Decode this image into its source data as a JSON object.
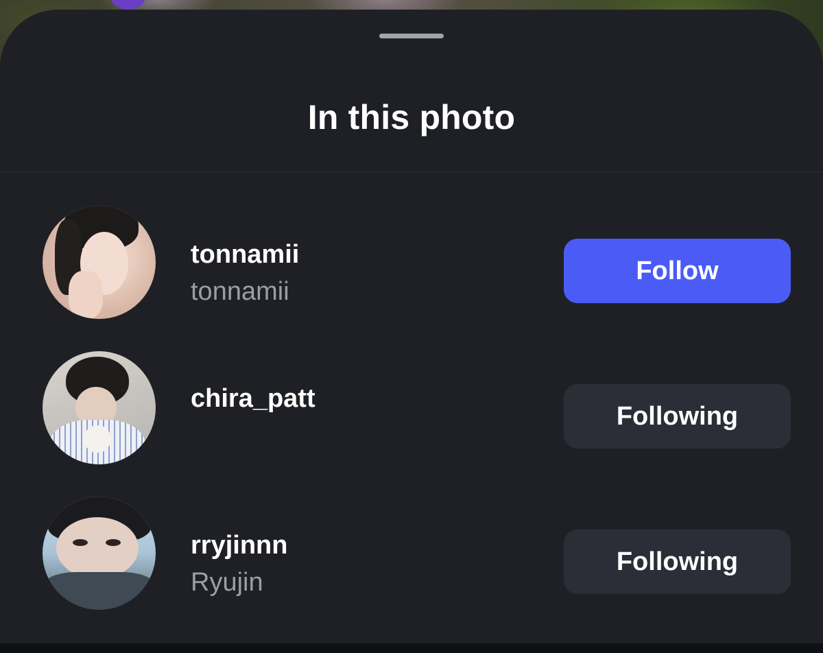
{
  "sheet": {
    "title": "In this photo"
  },
  "people": [
    {
      "username": "tonnamii",
      "display_name": "tonnamii",
      "button_label": "Follow",
      "button_state": "follow"
    },
    {
      "username": "chira_patt",
      "display_name": "",
      "button_label": "Following",
      "button_state": "following"
    },
    {
      "username": "rryjinnn",
      "display_name": "Ryujin",
      "button_label": "Following",
      "button_state": "following"
    }
  ],
  "colors": {
    "sheet_background": "#1f2025",
    "follow_button": "#4a5cf5",
    "following_button": "#2b2e36",
    "secondary_text": "#9a9ea6"
  }
}
